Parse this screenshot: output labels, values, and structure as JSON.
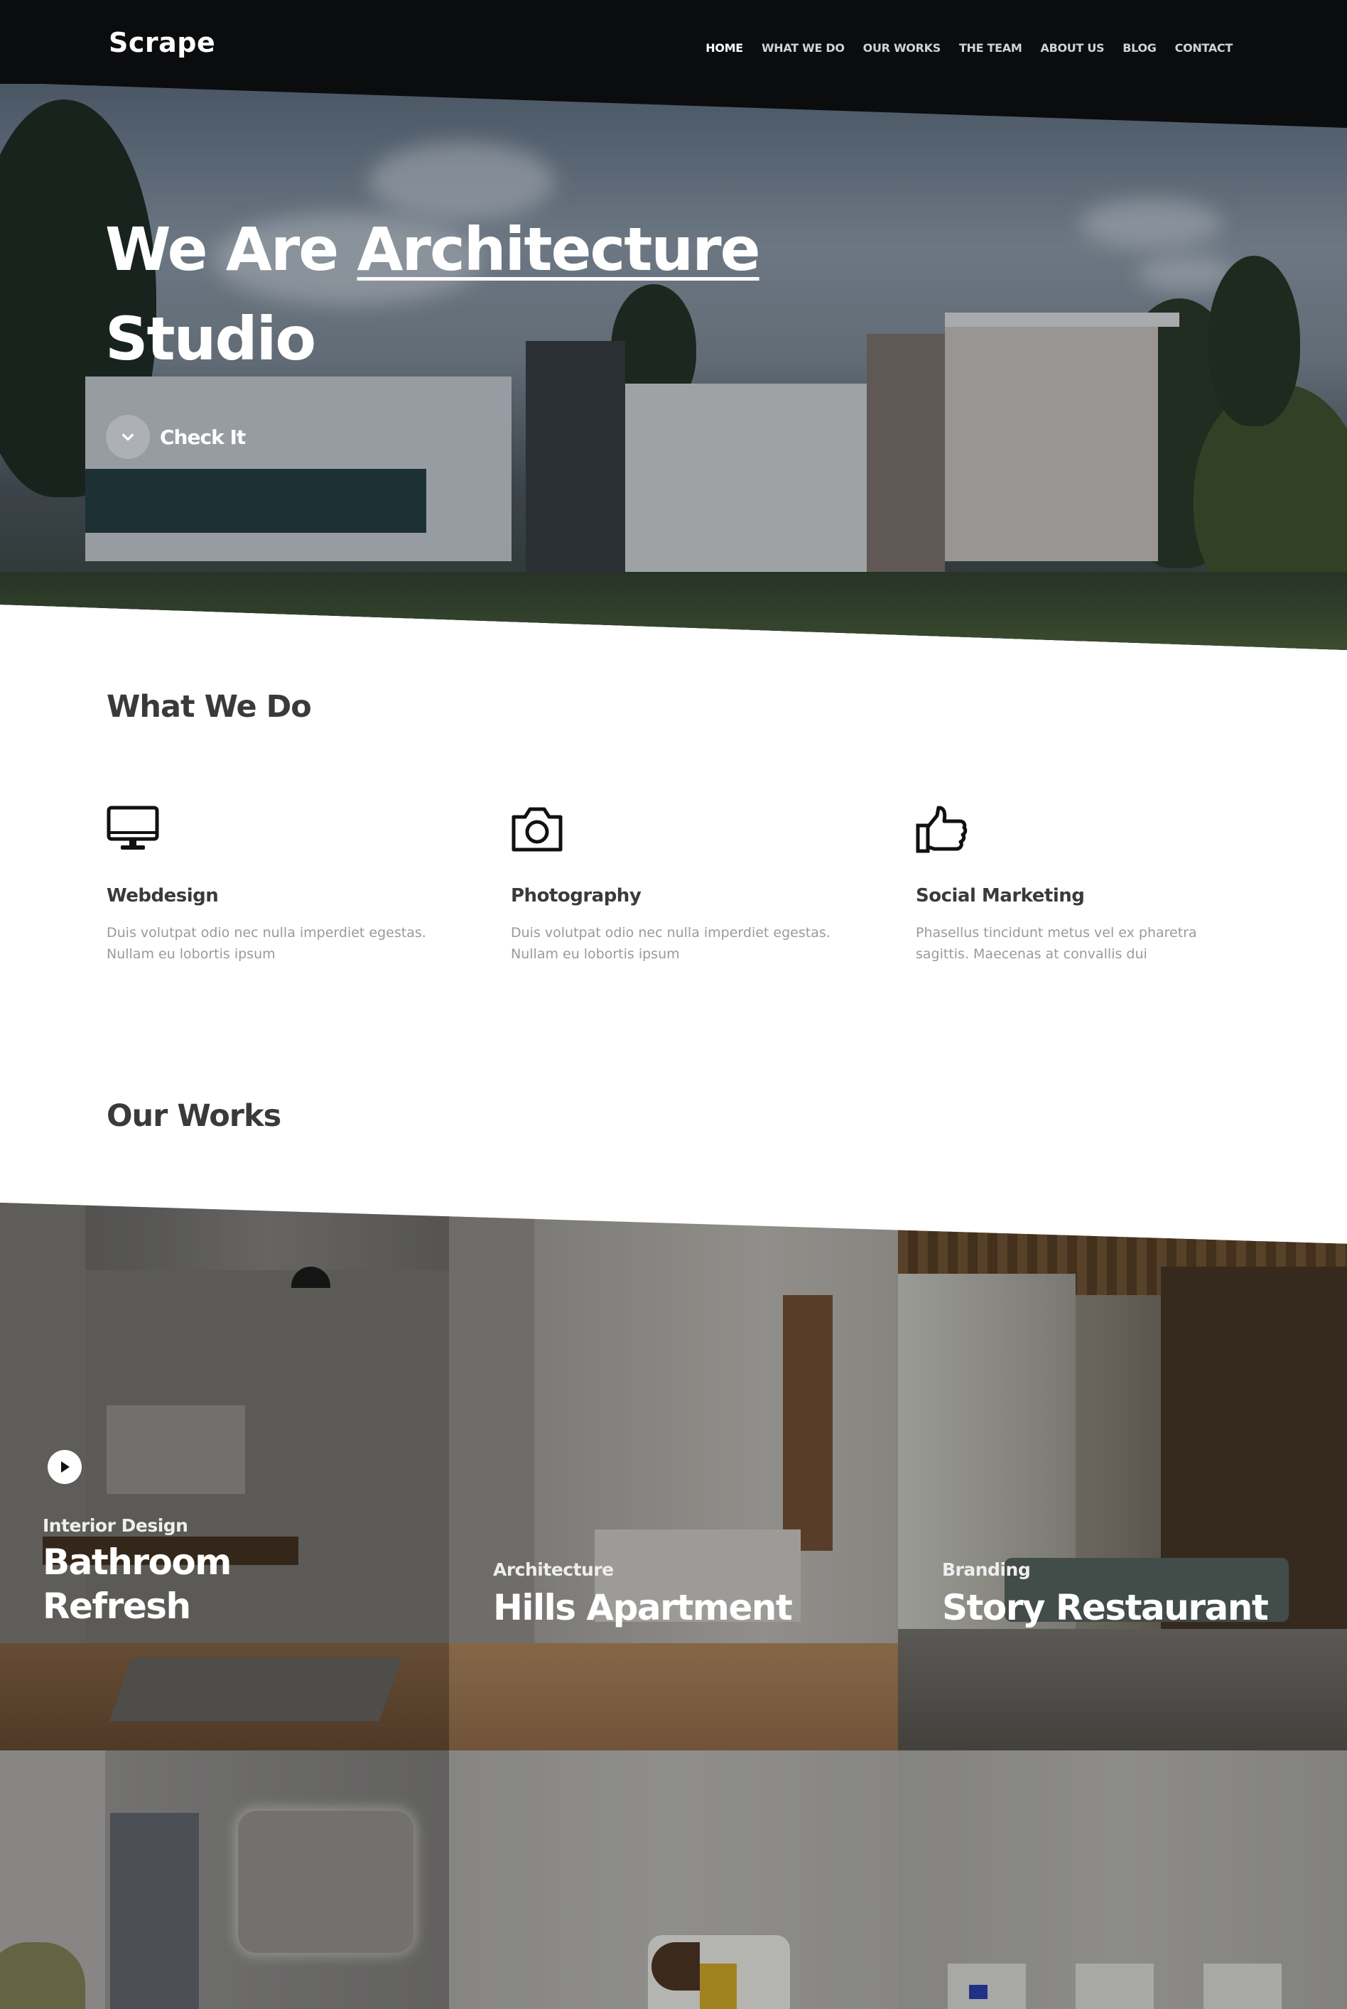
{
  "header": {
    "logo": "Scrape",
    "nav": [
      {
        "label": "HOME",
        "active": true
      },
      {
        "label": "WHAT WE DO",
        "active": false
      },
      {
        "label": "OUR WORKS",
        "active": false
      },
      {
        "label": "THE TEAM",
        "active": false
      },
      {
        "label": "ABOUT US",
        "active": false
      },
      {
        "label": "BLOG",
        "active": false
      },
      {
        "label": "CONTACT",
        "active": false
      }
    ]
  },
  "hero": {
    "title_prefix": "We Are ",
    "title_highlight": "Architecture",
    "title_suffix": "Studio",
    "cta_label": "Check It",
    "cta_icon": "chevron-down-icon"
  },
  "what_we_do": {
    "title": "What We Do",
    "services": [
      {
        "icon": "monitor-icon",
        "title": "Webdesign",
        "text": "Duis volutpat odio nec nulla imperdiet egestas. Nullam eu lobortis ipsum"
      },
      {
        "icon": "camera-icon",
        "title": "Photography",
        "text": "Duis volutpat odio nec nulla imperdiet egestas. Nullam eu lobortis ipsum"
      },
      {
        "icon": "thumbs-up-icon",
        "title": "Social Marketing",
        "text": "Phasellus tincidunt metus vel ex pharetra sagittis. Maecenas at convallis dui"
      }
    ]
  },
  "our_works": {
    "title": "Our Works",
    "items": [
      {
        "category": "Interior Design",
        "title": "Bathroom Refresh",
        "has_video": true
      },
      {
        "category": "Architecture",
        "title": "Hills Apartment",
        "has_video": false
      },
      {
        "category": "Branding",
        "title": "Story Restaurant",
        "has_video": false
      }
    ]
  },
  "colors": {
    "topbar": "#0b0c0e",
    "heading": "#3a3a3a",
    "body_text": "#9a9a9a",
    "white": "#ffffff"
  }
}
